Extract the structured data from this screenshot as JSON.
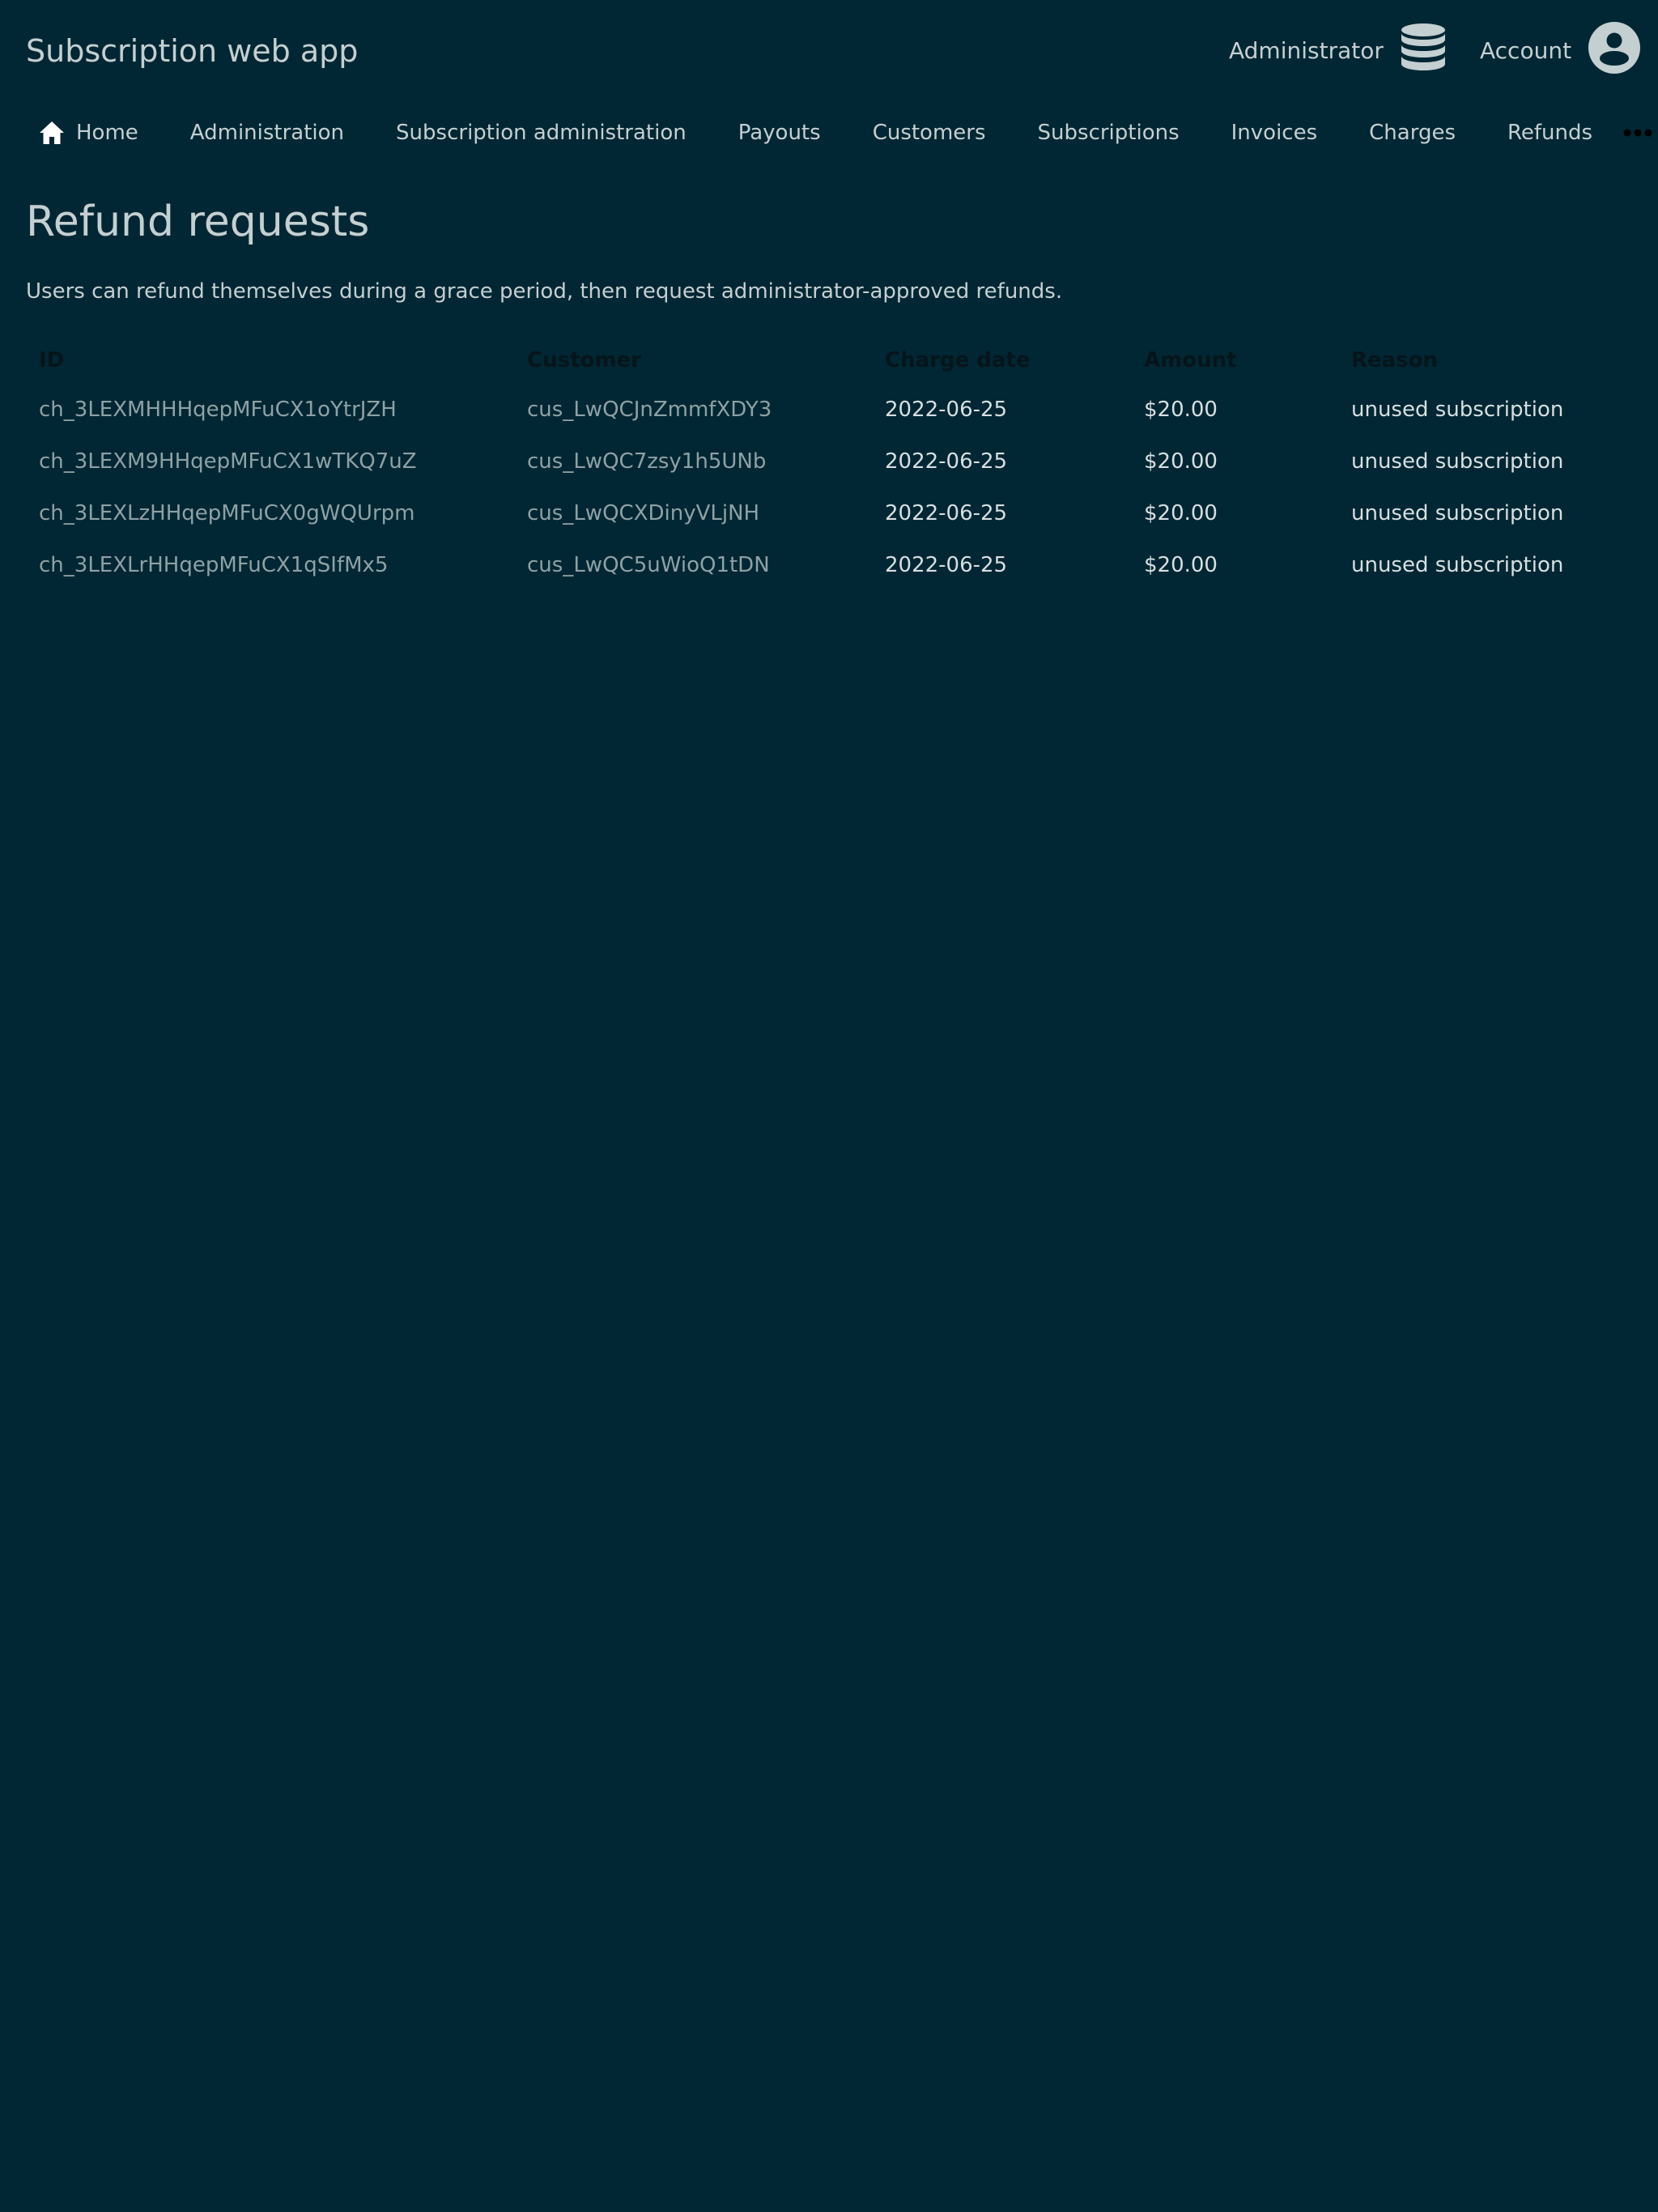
{
  "header": {
    "app_title": "Subscription web app",
    "admin_label": "Administrator",
    "admin_icon": "database-icon",
    "account_label": "Account",
    "account_icon": "user-circle-icon"
  },
  "nav": {
    "home_icon": "home-icon",
    "items": [
      {
        "label": "Home"
      },
      {
        "label": "Administration"
      },
      {
        "label": "Subscription administration"
      },
      {
        "label": "Payouts"
      },
      {
        "label": "Customers"
      },
      {
        "label": "Subscriptions"
      },
      {
        "label": "Invoices"
      },
      {
        "label": "Charges"
      },
      {
        "label": "Refunds"
      }
    ],
    "more_icon": "ellipsis-icon"
  },
  "main": {
    "title": "Refund requests",
    "description": "Users can refund themselves during a grace period, then request administrator-approved refunds.",
    "table": {
      "columns": [
        "ID",
        "Customer",
        "Charge date",
        "Amount",
        "Reason"
      ],
      "rows": [
        {
          "id": "ch_3LEXMHHHqepMFuCX1oYtrJZH",
          "customer": "cus_LwQCJnZmmfXDY3",
          "date": "2022-06-25",
          "amount": "$20.00",
          "reason": "unused subscription"
        },
        {
          "id": "ch_3LEXM9HHqepMFuCX1wTKQ7uZ",
          "customer": "cus_LwQC7zsy1h5UNb",
          "date": "2022-06-25",
          "amount": "$20.00",
          "reason": "unused subscription"
        },
        {
          "id": "ch_3LEXLzHHqepMFuCX0gWQUrpm",
          "customer": "cus_LwQCXDinyVLjNH",
          "date": "2022-06-25",
          "amount": "$20.00",
          "reason": "unused subscription"
        },
        {
          "id": "ch_3LEXLrHHqepMFuCX1qSIfMx5",
          "customer": "cus_LwQC5uWioQ1tDN",
          "date": "2022-06-25",
          "amount": "$20.00",
          "reason": "unused subscription"
        }
      ]
    }
  },
  "colors": {
    "background": "#002733",
    "text": "#c4cfd1",
    "link_muted": "#8ea1a5",
    "header_text": "#06151b"
  }
}
